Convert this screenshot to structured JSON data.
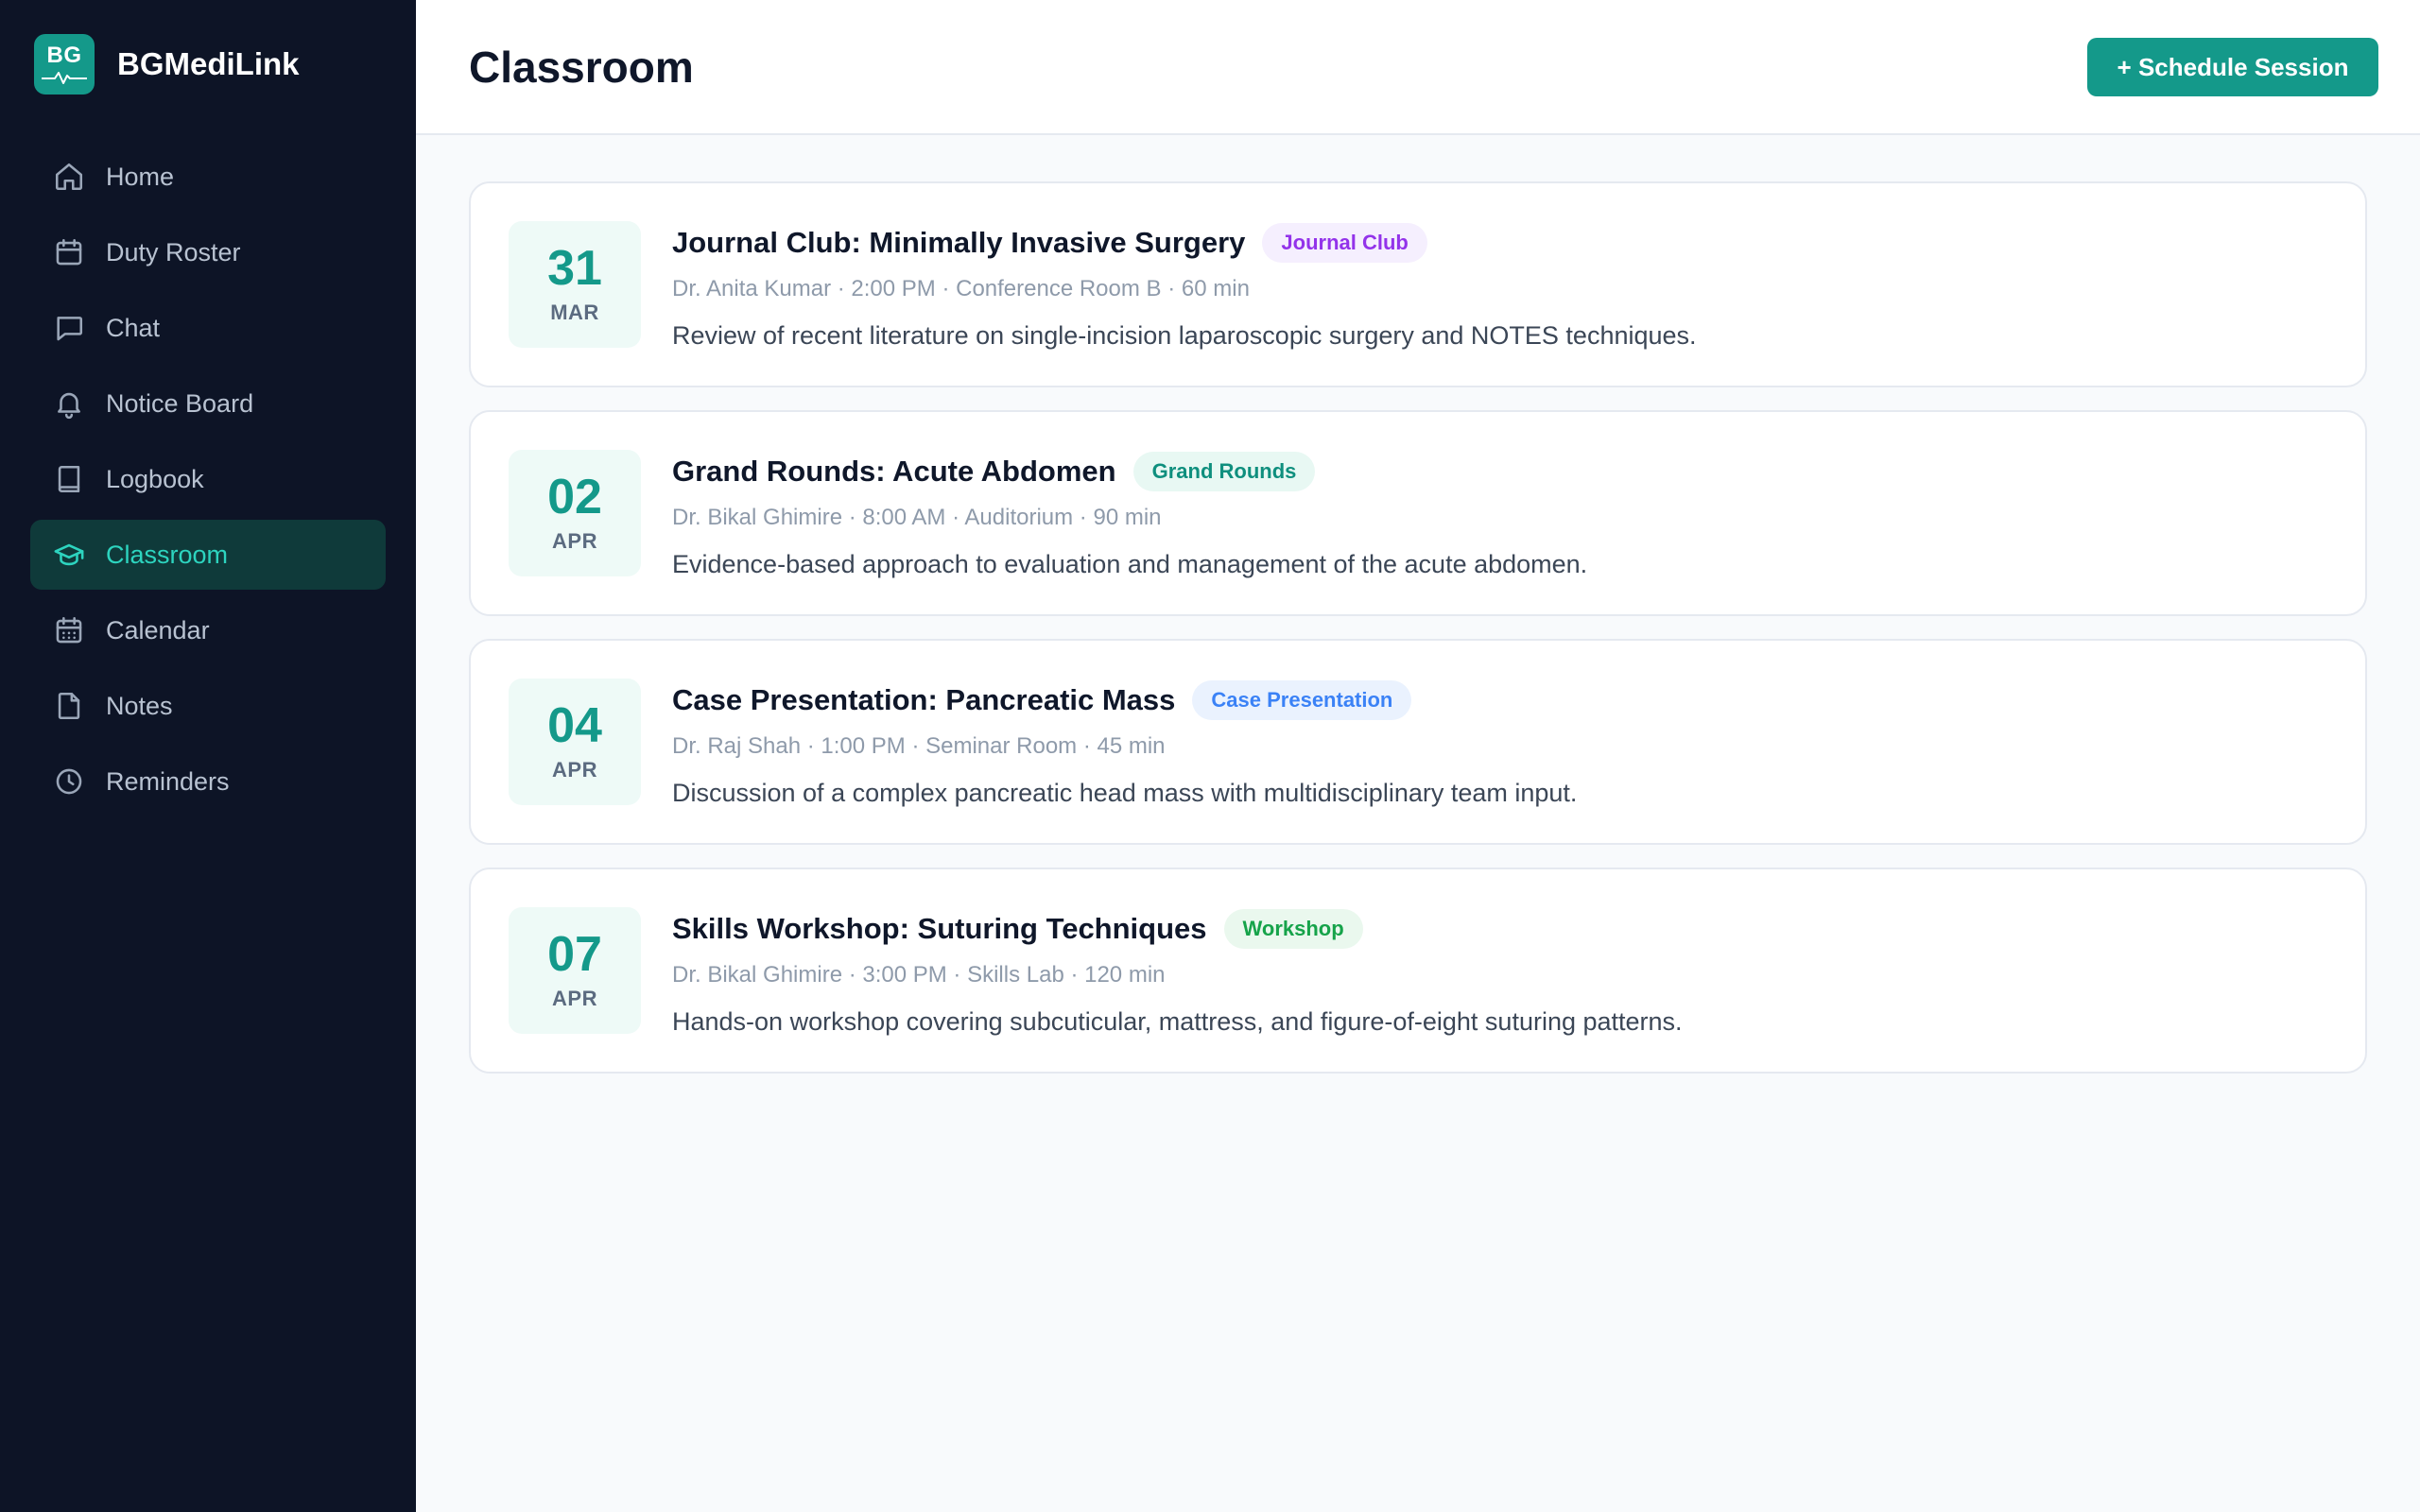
{
  "app": {
    "name": "BGMediLink",
    "logo_initials": "BG"
  },
  "sidebar": {
    "items": [
      {
        "label": "Home",
        "icon": "home-icon"
      },
      {
        "label": "Duty Roster",
        "icon": "calendar-icon"
      },
      {
        "label": "Chat",
        "icon": "chat-icon"
      },
      {
        "label": "Notice Board",
        "icon": "bell-icon"
      },
      {
        "label": "Logbook",
        "icon": "book-icon"
      },
      {
        "label": "Classroom",
        "icon": "graduation-cap-icon",
        "active": true
      },
      {
        "label": "Calendar",
        "icon": "calendar-grid-icon"
      },
      {
        "label": "Notes",
        "icon": "document-icon"
      },
      {
        "label": "Reminders",
        "icon": "clock-icon"
      }
    ]
  },
  "header": {
    "title": "Classroom",
    "action_label": "+ Schedule Session"
  },
  "sessions": [
    {
      "day": "31",
      "month": "MAR",
      "title": "Journal Club: Minimally Invasive Surgery",
      "tag": "Journal Club",
      "meta": "Dr. Anita Kumar · 2:00 PM · Conference Room B · 60 min",
      "description": "Review of recent literature on single-incision laparoscopic surgery and NOTES techniques."
    },
    {
      "day": "02",
      "month": "APR",
      "title": "Grand Rounds: Acute Abdomen",
      "tag": "Grand Rounds",
      "meta": "Dr. Bikal Ghimire · 8:00 AM · Auditorium · 90 min",
      "description": "Evidence-based approach to evaluation and management of the acute abdomen."
    },
    {
      "day": "04",
      "month": "APR",
      "title": "Case Presentation: Pancreatic Mass",
      "tag": "Case Presentation",
      "meta": "Dr. Raj Shah · 1:00 PM · Seminar Room · 45 min",
      "description": "Discussion of a complex pancreatic head mass with multidisciplinary team input."
    },
    {
      "day": "07",
      "month": "APR",
      "title": "Skills Workshop: Suturing Techniques",
      "tag": "Workshop",
      "meta": "Dr. Bikal Ghimire · 3:00 PM · Skills Lab · 120 min",
      "description": "Hands-on workshop covering subcuticular, mattress, and figure-of-eight suturing patterns."
    }
  ],
  "colors": {
    "accent": "#14998a",
    "sidebar_bg": "#0d1426",
    "active_nav_bg": "#0f3a3a",
    "active_nav_text": "#2dd4bf"
  }
}
